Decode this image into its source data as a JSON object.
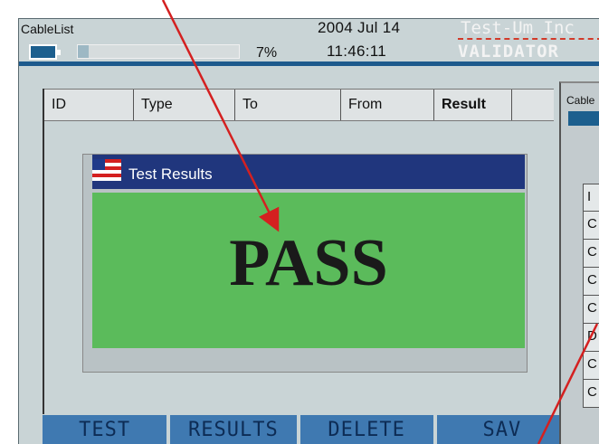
{
  "status": {
    "app_title": "CableList",
    "date": "2004 Jul 14",
    "time": "11:46:11",
    "battery_percent": "7%",
    "progress_fraction": 0.07,
    "brand_name": "Test-Um Inc",
    "brand_product": "VALIDATOR"
  },
  "table": {
    "headers": [
      "ID",
      "Type",
      "To",
      "From",
      "Result"
    ]
  },
  "dialog": {
    "title": "Test Results",
    "result": "PASS"
  },
  "softkeys": [
    "TEST",
    "RESULTS",
    "DELETE",
    "SAV"
  ],
  "second_window": {
    "title": "Cable",
    "rows": [
      "I",
      "C",
      "C",
      "C",
      "C",
      "D",
      "C",
      "C"
    ]
  },
  "colors": {
    "screen_bg": "#c9d4d6",
    "pass_green": "#5bbb5b",
    "titlebar_blue": "#20367d",
    "softkey_blue": "#3f79b1",
    "arrow_red": "#d42020"
  }
}
